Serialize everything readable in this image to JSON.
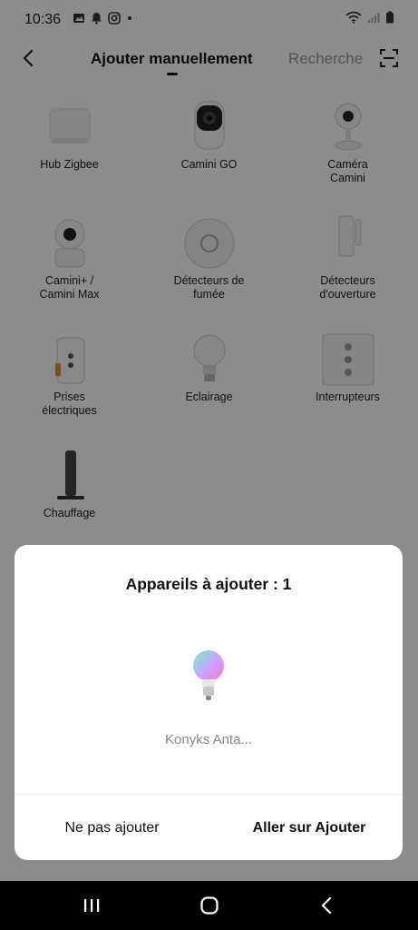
{
  "status_bar": {
    "time": "10:36",
    "left_icons": [
      "photo-icon",
      "notification-bell-icon",
      "instagram-icon",
      "dot-icon"
    ],
    "right_icons": [
      "wifi-icon",
      "signal-icon",
      "battery-icon"
    ]
  },
  "header": {
    "title": "Ajouter manuellement",
    "search_label": "Recherche"
  },
  "devices": [
    {
      "label": "Hub Zigbee",
      "icon": "zigbee-hub-icon"
    },
    {
      "label": "Camini GO",
      "icon": "camera-go-icon"
    },
    {
      "label": "Caméra\nCamini",
      "icon": "indoor-camera-icon"
    },
    {
      "label": "Camini+ /\nCamini Max",
      "icon": "ptz-camera-icon"
    },
    {
      "label": "Détecteurs de\nfumée",
      "icon": "smoke-detector-icon"
    },
    {
      "label": "Détecteurs\nd'ouverture",
      "icon": "door-sensor-icon"
    },
    {
      "label": "Prises\nélectriques",
      "icon": "smart-plug-icon"
    },
    {
      "label": "Eclairage",
      "icon": "bulb-icon"
    },
    {
      "label": "Interrupteurs",
      "icon": "switch-icon"
    },
    {
      "label": "Chauffage",
      "icon": "heater-icon"
    }
  ],
  "dialog": {
    "title": "Appareils à ajouter : 1",
    "device_name": "Konyks Anta...",
    "device_icon": "rgb-bulb-icon",
    "skip_label": "Ne pas ajouter",
    "confirm_label": "Aller sur Ajouter"
  },
  "nav": {
    "icons": [
      "recent-apps-icon",
      "home-icon",
      "back-icon"
    ]
  }
}
